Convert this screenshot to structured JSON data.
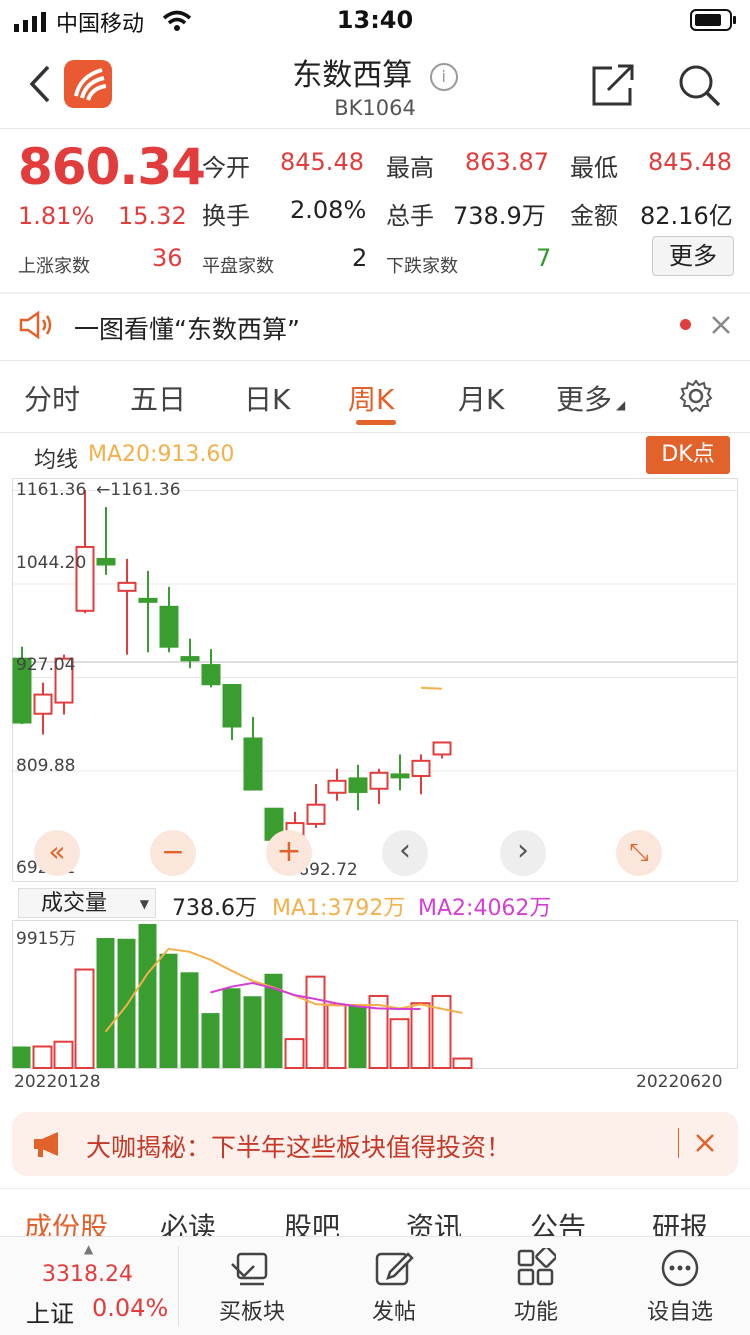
{
  "status_bar": {
    "carrier": "中国移动",
    "time": "13:40"
  },
  "header": {
    "title": "东数西算",
    "code": "BK1064"
  },
  "quote": {
    "price": "860.34",
    "change_pct": "1.81%",
    "change": "15.32",
    "open_label": "今开",
    "open": "845.48",
    "high_label": "最高",
    "high": "863.87",
    "low_label": "最低",
    "low": "845.48",
    "turnover_label": "换手",
    "turnover": "2.08%",
    "volume_label": "总手",
    "volume": "738.9万",
    "amount_label": "金额",
    "amount": "82.16亿",
    "up_label": "上涨家数",
    "up_count": "36",
    "flat_label": "平盘家数",
    "flat_count": "2",
    "down_label": "下跌家数",
    "down_count": "7",
    "more_button": "更多"
  },
  "notice": {
    "text": "一图看懂“东数西算”"
  },
  "tabs": [
    {
      "label": "分时",
      "active": false
    },
    {
      "label": "五日",
      "active": false
    },
    {
      "label": "日K",
      "active": false
    },
    {
      "label": "周K",
      "active": true
    },
    {
      "label": "月K",
      "active": false
    },
    {
      "label": "更多",
      "active": false
    }
  ],
  "chart_header": {
    "ma_label": "均线",
    "ma_value": "MA20:913.60",
    "dk_button": "DK点"
  },
  "volume_header": {
    "selector": "成交量",
    "value": "738.6万",
    "ma1": "MA1:3792万",
    "ma2": "MA2:4062万"
  },
  "colors": {
    "up": "#e23c3c",
    "down": "#3a9d2f",
    "accent": "#e2622b",
    "ma1": "#f4b04a",
    "ma2": "#d43fd4"
  },
  "chart_data": [
    {
      "type": "candlestick",
      "y_ticks": [
        "1161.36",
        "1044.20",
        "927.04",
        "809.88",
        "692.72"
      ],
      "ylim": [
        692.72,
        1161.36
      ],
      "annotations": {
        "high_marker": "1161.36",
        "low_marker": "692.72"
      },
      "candles": [
        {
          "o": 950,
          "c": 870,
          "h": 965,
          "l": 868,
          "up": false
        },
        {
          "o": 881,
          "c": 905,
          "h": 920,
          "l": 855,
          "up": true
        },
        {
          "o": 895,
          "c": 950,
          "h": 955,
          "l": 880,
          "up": true
        },
        {
          "o": 1010,
          "c": 1090,
          "h": 1161.36,
          "l": 1007,
          "up": true
        },
        {
          "o": 1075,
          "c": 1068,
          "h": 1140,
          "l": 1055,
          "up": false
        },
        {
          "o": 1035,
          "c": 1045,
          "h": 1075,
          "l": 955,
          "up": true
        },
        {
          "o": 1025,
          "c": 1022,
          "h": 1060,
          "l": 958,
          "up": false
        },
        {
          "o": 1015,
          "c": 965,
          "h": 1040,
          "l": 958,
          "up": false
        },
        {
          "o": 952,
          "c": 948,
          "h": 975,
          "l": 938,
          "up": false
        },
        {
          "o": 942,
          "c": 918,
          "h": 962,
          "l": 914,
          "up": false
        },
        {
          "o": 917,
          "c": 865,
          "h": 918,
          "l": 848,
          "up": false
        },
        {
          "o": 850,
          "c": 786,
          "h": 877,
          "l": 785,
          "up": false
        },
        {
          "o": 762,
          "c": 723,
          "h": 763,
          "l": 692.72,
          "up": false
        },
        {
          "o": 724,
          "c": 744,
          "h": 758,
          "l": 709,
          "up": true
        },
        {
          "o": 743,
          "c": 767,
          "h": 793,
          "l": 738,
          "up": true
        },
        {
          "o": 782,
          "c": 797,
          "h": 812,
          "l": 772,
          "up": true
        },
        {
          "o": 800,
          "c": 783,
          "h": 817,
          "l": 760,
          "up": false
        },
        {
          "o": 787,
          "c": 807,
          "h": 812,
          "l": 768,
          "up": true
        },
        {
          "o": 805,
          "c": 805,
          "h": 830,
          "l": 785,
          "up": false
        },
        {
          "o": 803,
          "c": 822,
          "h": 830,
          "l": 780,
          "up": true
        },
        {
          "o": 830,
          "c": 845,
          "h": 845,
          "l": 825,
          "up": true
        }
      ],
      "ma20_segment": [
        {
          "i": 19,
          "v": 913.6
        },
        {
          "i": 20,
          "v": 912.3
        }
      ]
    },
    {
      "type": "bar",
      "title": "成交量",
      "y_ticks": [
        "9915万"
      ],
      "ylim": [
        0,
        9915
      ],
      "x_labels": [
        "20220128",
        "20220620"
      ],
      "values": [
        1480,
        1480,
        1810,
        6780,
        8950,
        8900,
        9915,
        7870,
        6590,
        3780,
        5490,
        4940,
        6490,
        1990,
        6290,
        4360,
        4360,
        4960,
        3360,
        4460,
        4960,
        650
      ],
      "up": [
        false,
        true,
        true,
        true,
        false,
        false,
        false,
        false,
        false,
        false,
        false,
        false,
        false,
        true,
        true,
        true,
        false,
        true,
        true,
        true,
        true,
        true
      ],
      "ma1": [
        null,
        null,
        null,
        null,
        2500,
        4300,
        6500,
        8200,
        8000,
        7450,
        6700,
        6000,
        5550,
        5000,
        4400,
        4300,
        4350,
        4340,
        4100,
        4380,
        4080,
        3792
      ],
      "ma2": [
        null,
        null,
        null,
        null,
        null,
        null,
        null,
        null,
        null,
        5200,
        5600,
        5850,
        5500,
        5020,
        4750,
        4450,
        4240,
        4100,
        4060,
        4062
      ]
    }
  ],
  "chart_controls": [
    "«",
    "−",
    "+",
    "‹",
    "›",
    "⤡"
  ],
  "promo_banner": {
    "text": "大咖揭秘：下半年这些板块值得投资！"
  },
  "sub_tabs": [
    "成份股",
    "必读",
    "股吧",
    "资讯",
    "公告",
    "研报"
  ],
  "bottom_bar": {
    "index_value": "3318.24",
    "index_name": "上证",
    "index_change": "0.04%",
    "items": [
      {
        "label": "买板块",
        "icon": "buy-sector-icon"
      },
      {
        "label": "发帖",
        "icon": "edit-icon"
      },
      {
        "label": "功能",
        "icon": "grid-icon"
      },
      {
        "label": "设自选",
        "icon": "more-circle-icon"
      }
    ]
  }
}
